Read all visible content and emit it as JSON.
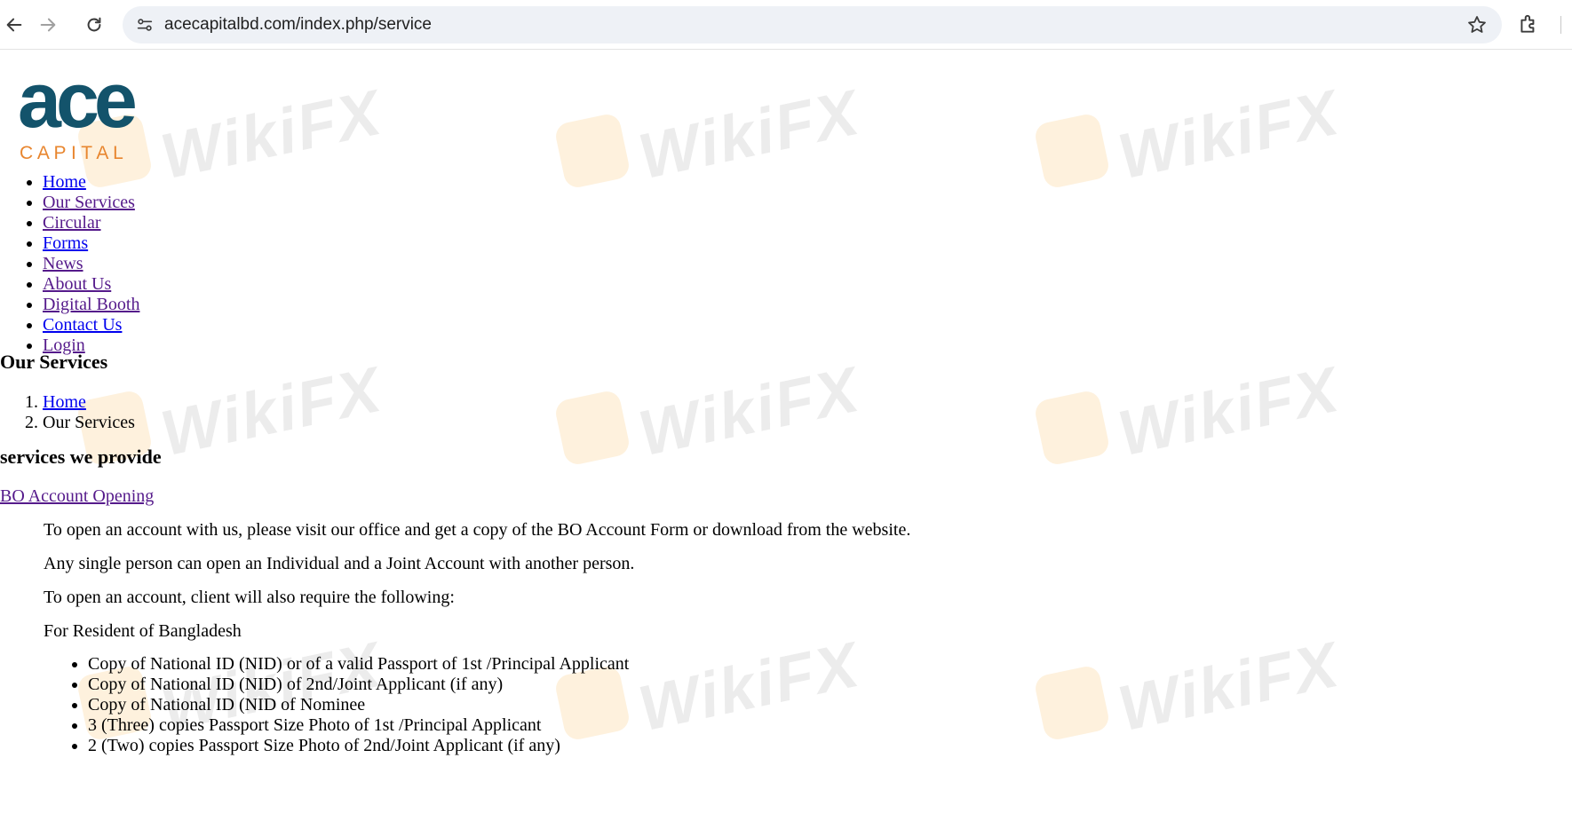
{
  "browser": {
    "url": "acecapitalbd.com/index.php/service"
  },
  "logo": {
    "brand_top": "ace",
    "brand_bottom": "C A P I T A L"
  },
  "watermark_text": "WikiFX",
  "nav": {
    "items": [
      {
        "label": "Home"
      },
      {
        "label": "Our Services"
      },
      {
        "label": "Circular"
      },
      {
        "label": "Forms"
      },
      {
        "label": "News"
      },
      {
        "label": "About Us"
      },
      {
        "label": "Digital Booth"
      },
      {
        "label": "Contact Us"
      },
      {
        "label": "Login"
      }
    ]
  },
  "page_title": "Our Services",
  "breadcrumb": {
    "items": [
      "Home",
      "Our Services"
    ]
  },
  "section_title": "services we provide",
  "service_link": "BO Account Opening",
  "paragraphs": [
    "To open an account with us, please visit our office and get a copy of the BO Account Form or download from the website.",
    "Any single person can open an Individual and a Joint Account with another person.",
    "To open an account, client will also require the following:",
    "For Resident of Bangladesh"
  ],
  "requirements": [
    "Copy of National ID (NID) or of a valid Passport of 1st /Principal Applicant",
    "Copy of National ID (NID) of 2nd/Joint Applicant (if any)",
    "Copy of National ID (NID of Nominee",
    "3 (Three) copies Passport Size Photo of 1st /Principal Applicant",
    "2 (Two) copies Passport Size Photo of 2nd/Joint Applicant (if any)"
  ],
  "colors": {
    "link": "#0000ee",
    "visited_link": "#551a8b",
    "logo_teal": "#13536b",
    "logo_orange": "#e8862f"
  }
}
